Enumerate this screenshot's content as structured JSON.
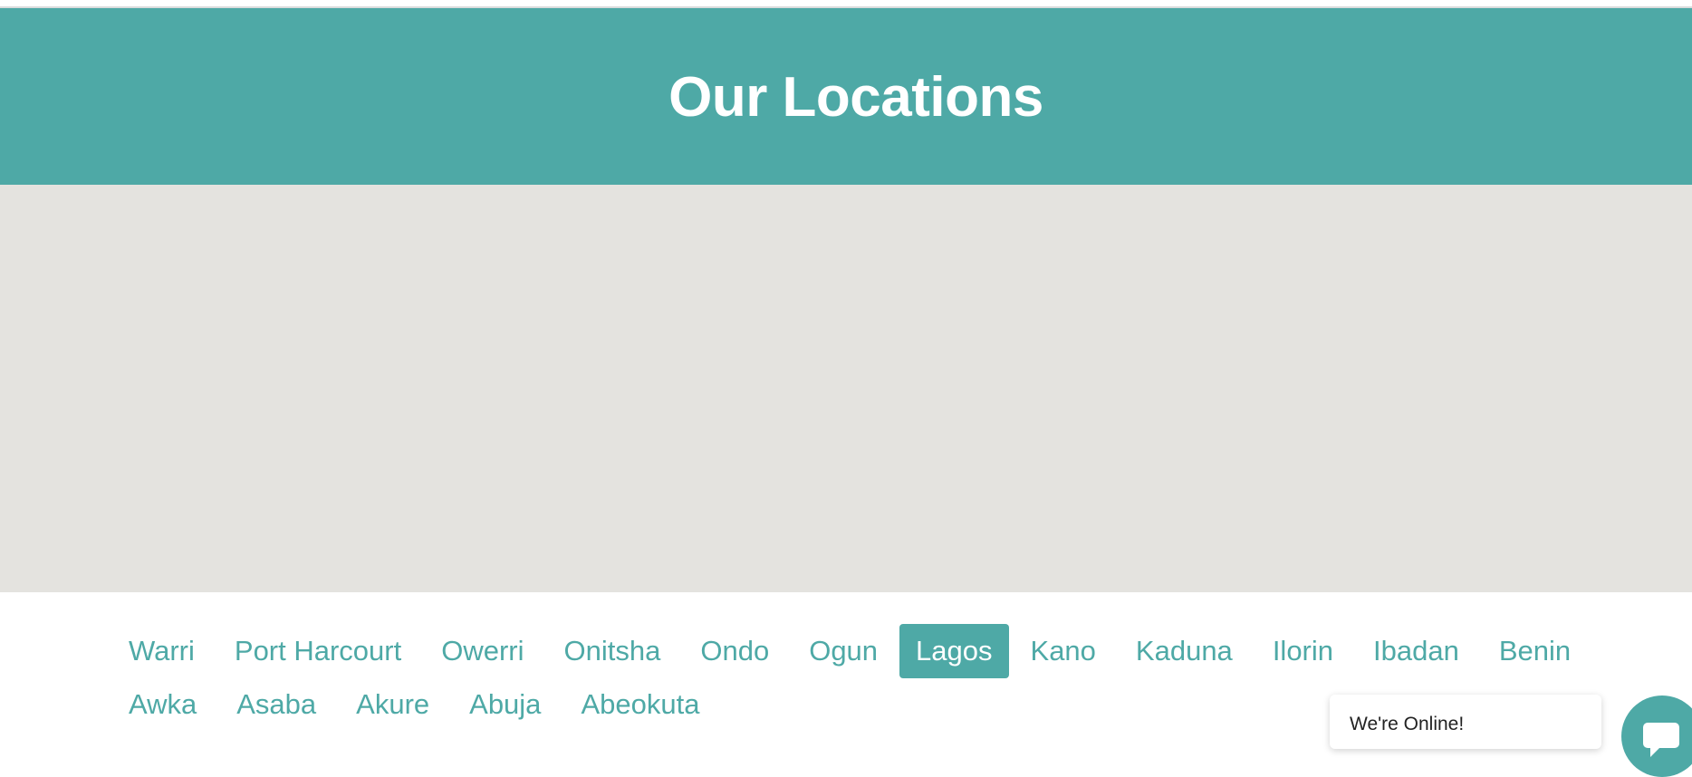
{
  "header": {
    "title": "Our Locations",
    "background_color": "#4ea9a6"
  },
  "map": {
    "background_color": "#e4e3df"
  },
  "locations": {
    "active": "Lagos",
    "row1": [
      "Warri",
      "Port Harcourt",
      "Owerri",
      "Onitsha",
      "Ondo",
      "Ogun",
      "Lagos",
      "Kano",
      "Kaduna",
      "Ilorin",
      "Ibadan",
      "Benin"
    ],
    "row2": [
      "Awka",
      "Asaba",
      "Akure",
      "Abuja",
      "Abeokuta"
    ]
  },
  "chat": {
    "status_text": "We're Online!",
    "launcher_icon": "chat-icon"
  }
}
